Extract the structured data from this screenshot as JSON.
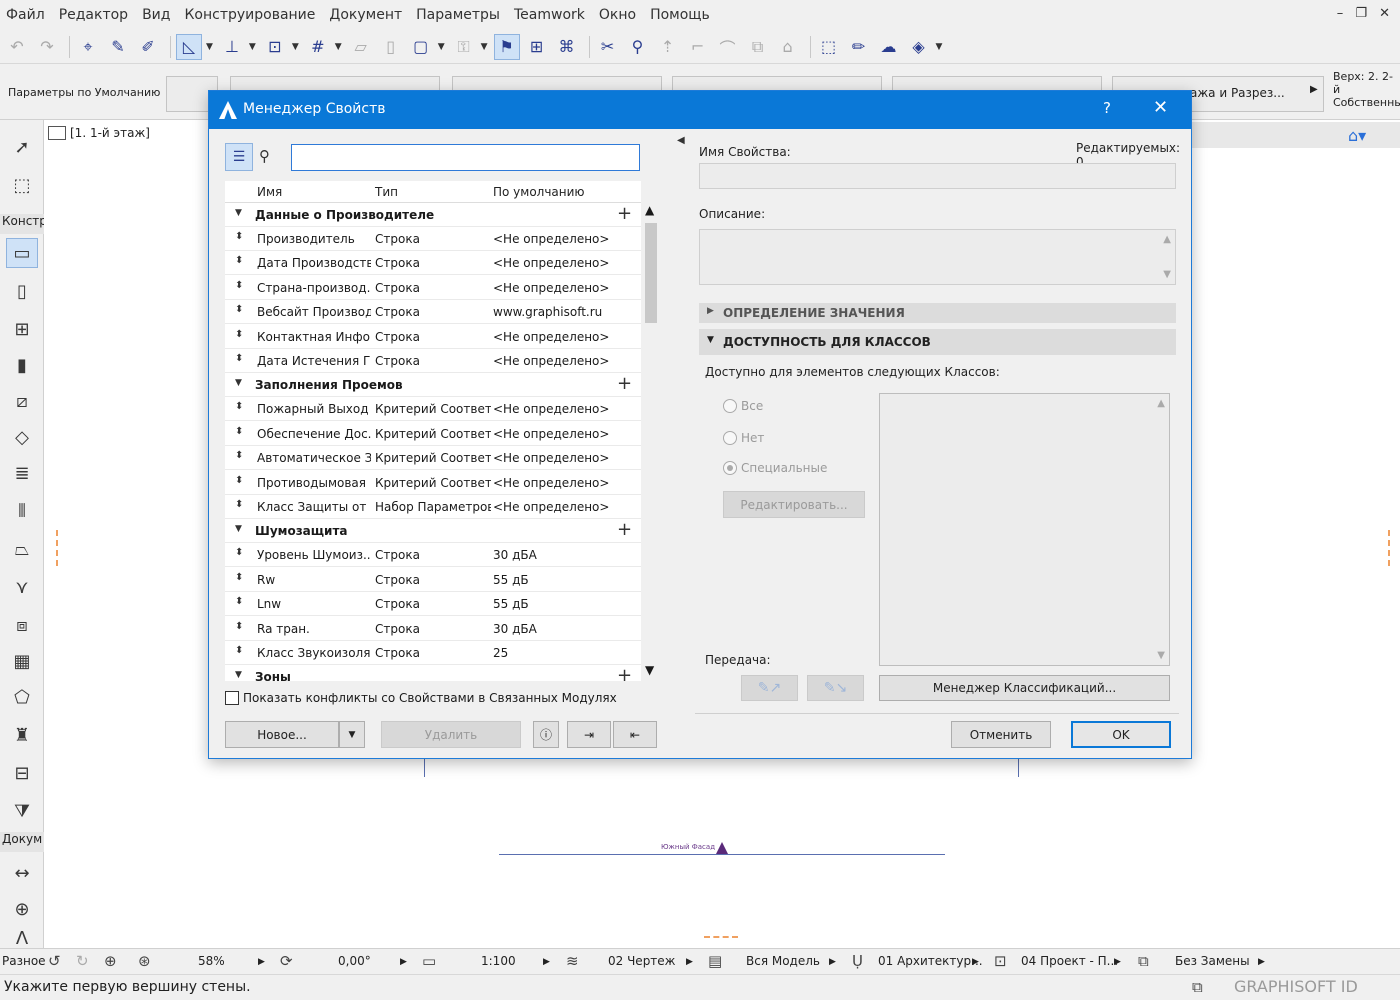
{
  "menu": [
    "Файл",
    "Редактор",
    "Вид",
    "Конструирование",
    "Документ",
    "Параметры",
    "Teamwork",
    "Окно",
    "Помощь"
  ],
  "window_controls": "– ❐ ✕",
  "toolbar_icons": [
    "undo-icon",
    "redo-icon",
    "pick-icon",
    "eyedropper-icon",
    "syringe-icon",
    "guide-icon",
    "snap-icon",
    "grid-icon",
    "layers-icon",
    "model-icon",
    "3d-icon"
  ],
  "infobar": {
    "default_params": "Параметры по Умолчанию",
    "floors_sections": "…ажа и Разрез...",
    "top_label": "Верх:  2. 2-й",
    "own_label": "Собственный"
  },
  "toolbox": {
    "section_construct": "Констр",
    "section_docs": "Докум",
    "section_misc": "Разное"
  },
  "floor_tab": "[1. 1-й этаж]",
  "canvas": {
    "facade_label": "Южный Фасад"
  },
  "statusbar": {
    "zoom": "58%",
    "angle": "0,00°",
    "scale": "1:100",
    "drawing": "02 Чертеж",
    "model": "Вся Модель",
    "arch": "01 Архитектур...",
    "project": "04 Проект - П...",
    "replace": "Без Замены"
  },
  "prompt": "Укажите первую вершину стены.",
  "brand": "GRAPHISOFT ID",
  "dialog": {
    "title": "Менеджер Свойств",
    "help": "?",
    "close": "✕",
    "search_value": "",
    "columns": {
      "name": "Имя",
      "type": "Тип",
      "default": "По умолчанию"
    },
    "groups": [
      {
        "name": "Данные о Производителе",
        "rows": [
          {
            "name": "Производитель",
            "type": "Строка",
            "default": "<Не определено>"
          },
          {
            "name": "Дата Производства",
            "type": "Строка",
            "default": "<Не определено>"
          },
          {
            "name": "Страна-производ...",
            "type": "Строка",
            "default": "<Не определено>"
          },
          {
            "name": "Вебсайт Производ...",
            "type": "Строка",
            "default": "www.graphisoft.ru"
          },
          {
            "name": "Контактная Инфо...",
            "type": "Строка",
            "default": "<Не определено>"
          },
          {
            "name": "Дата Истечения Г...",
            "type": "Строка",
            "default": "<Не определено>"
          }
        ]
      },
      {
        "name": "Заполнения Проемов",
        "rows": [
          {
            "name": "Пожарный Выход",
            "type": "Критерий Соответ...",
            "default": "<Не определено>"
          },
          {
            "name": "Обеспечение Дос...",
            "type": "Критерий Соответ...",
            "default": "<Не определено>"
          },
          {
            "name": "Автоматическое З...",
            "type": "Критерий Соответ...",
            "default": "<Не определено>"
          },
          {
            "name": "Противодымовая ...",
            "type": "Критерий Соответ...",
            "default": "<Не определено>"
          },
          {
            "name": "Класс Защиты от ...",
            "type": "Набор Параметров",
            "default": "<Не определено>"
          }
        ]
      },
      {
        "name": "Шумозащита",
        "rows": [
          {
            "name": "Уровень Шумоиз...",
            "type": "Строка",
            "default": "30 дБА"
          },
          {
            "name": "Rw",
            "type": "Строка",
            "default": "55 дБ"
          },
          {
            "name": "Lnw",
            "type": "Строка",
            "default": "55 дБ"
          },
          {
            "name": "Ra тран.",
            "type": "Строка",
            "default": "30 дБА"
          },
          {
            "name": "Класс Звукоизоля...",
            "type": "Строка",
            "default": "25"
          }
        ]
      },
      {
        "name": "Зоны",
        "rows": []
      }
    ],
    "show_conflicts": "Показать конфликты со Свойствами в Связанных Модулях",
    "btn_new": "Новое...",
    "btn_delete": "Удалить",
    "prop_name_label": "Имя Свойства:",
    "editable_label": "Редактируемых: 0",
    "description_label": "Описание:",
    "section_value": "ОПРЕДЕЛЕНИЕ ЗНАЧЕНИЯ",
    "section_classes": "ДОСТУПНОСТЬ ДЛЯ КЛАССОВ",
    "available_label": "Доступно для элементов следующих Классов:",
    "radio_all": "Все",
    "radio_none": "Нет",
    "radio_special": "Специальные",
    "btn_edit": "Редактировать...",
    "transfer_label": "Передача:",
    "btn_class_manager": "Менеджер Классификаций...",
    "btn_cancel": "Отменить",
    "btn_ok": "OK"
  }
}
